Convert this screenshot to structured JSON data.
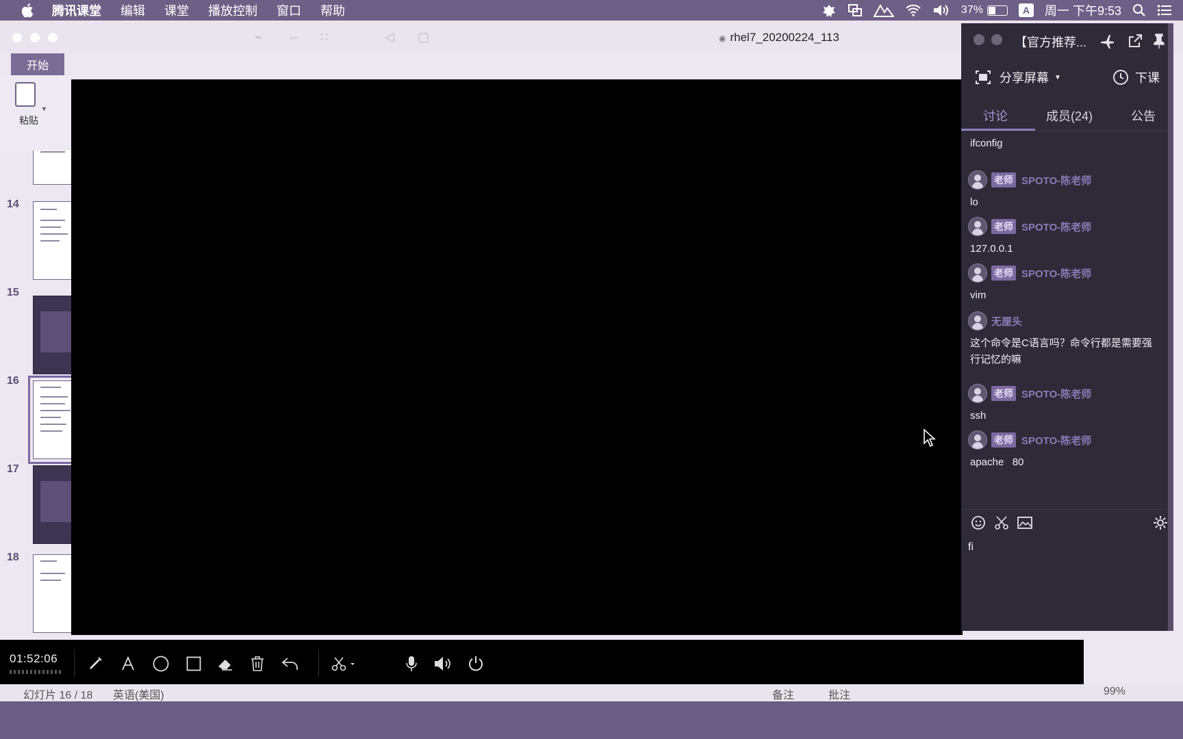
{
  "menubar": {
    "apple_icon": "apple-logo-icon",
    "items": [
      "腾讯课堂",
      "编辑",
      "课堂",
      "播放控制",
      "窗口",
      "帮助"
    ],
    "battery_percent": "37%",
    "battery_level": 0.37,
    "input_method": "A",
    "clock": "周一 下午9:53"
  },
  "ppt": {
    "doc_title": "rhel7_20200224_113",
    "ribbon_tab": "开始",
    "paste_label": "粘贴",
    "slide_numbers": [
      "14",
      "15",
      "16",
      "17",
      "18"
    ],
    "selected_slide": "16",
    "status": {
      "slide_info": "幻灯片 16 / 18",
      "language": "英语(美国)",
      "notes": "备注",
      "comments": "批注",
      "zoom": "99%"
    }
  },
  "toolbar": {
    "timer": "01:52:06",
    "tools": [
      "pen-icon",
      "text-icon",
      "circle-icon",
      "rectangle-icon",
      "eraser-icon",
      "trash-icon",
      "undo-icon",
      "scissors-icon",
      "microphone-icon",
      "speaker-icon",
      "power-icon"
    ]
  },
  "panel": {
    "title": "【官方推荐...",
    "share_label": "分享屏幕",
    "end_class_label": "下课",
    "tabs": [
      {
        "label": "讨论",
        "active": true
      },
      {
        "label": "成员(24)",
        "active": false
      },
      {
        "label": "公告",
        "active": false
      }
    ],
    "messages": [
      {
        "text": "ifconfig"
      },
      {
        "role": "老师",
        "sender": "SPOTO-陈老师",
        "text": "lo"
      },
      {
        "role": "老师",
        "sender": "SPOTO-陈老师",
        "text": "127.0.0.1"
      },
      {
        "role": "老师",
        "sender": "SPOTO-陈老师",
        "text": "vim"
      },
      {
        "role": "",
        "sender": "无厘头",
        "text": "这个命令是C语言吗？命令行都是需要强行记忆的嘛"
      },
      {
        "role": "老师",
        "sender": "SPOTO-陈老师",
        "text": "ssh"
      },
      {
        "role": "老师",
        "sender": "SPOTO-陈老师",
        "text": "apache   80"
      }
    ],
    "compose_value": "fi",
    "accent_color": "#8b7fbd"
  }
}
